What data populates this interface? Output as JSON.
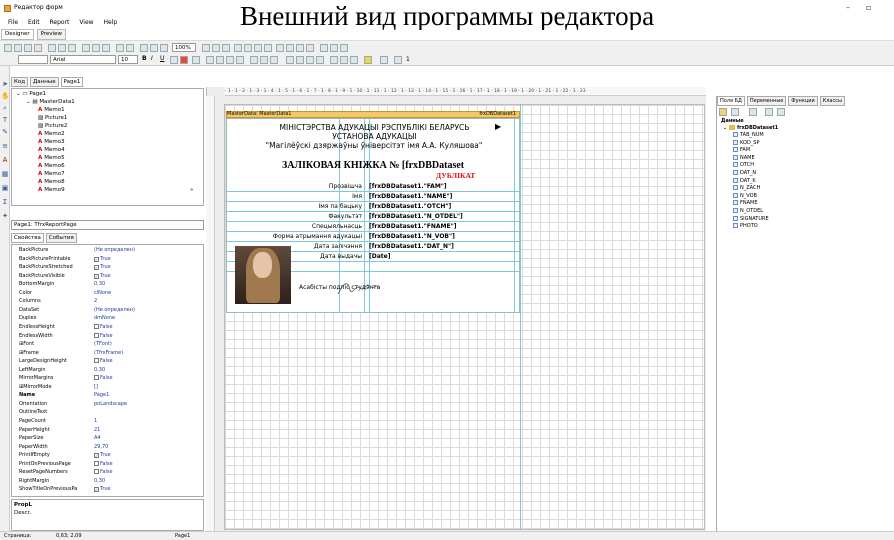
{
  "caption": "Внешний вид программы редактора",
  "window": {
    "title": "Редактор форм",
    "controls": [
      "–",
      "▫"
    ]
  },
  "menu": [
    "File",
    "Edit",
    "Report",
    "View",
    "Help"
  ],
  "mode_tabs": [
    "Designer",
    "Preview"
  ],
  "toolbar": {
    "zoom": "100%",
    "font_name": "Arial",
    "font_size": "10",
    "bold": "B",
    "italic": "I",
    "underline": "U",
    "line_width": "1"
  },
  "left_panel_tabs": [
    "Код",
    "Данные",
    "Page1"
  ],
  "tree": {
    "items": [
      {
        "label": "Page1",
        "level": 0,
        "icon": "page-icon"
      },
      {
        "label": "MasterData1",
        "level": 1,
        "icon": "band-icon"
      },
      {
        "label": "Memo1",
        "level": 2,
        "icon": "memo-icon"
      },
      {
        "label": "Picture1",
        "level": 2,
        "icon": "picture-icon"
      },
      {
        "label": "Picture2",
        "level": 2,
        "icon": "picture-icon"
      },
      {
        "label": "Memo2",
        "level": 2,
        "icon": "memo-icon"
      },
      {
        "label": "Memo3",
        "level": 2,
        "icon": "memo-icon"
      },
      {
        "label": "Memo4",
        "level": 2,
        "icon": "memo-icon"
      },
      {
        "label": "Memo5",
        "level": 2,
        "icon": "memo-icon"
      },
      {
        "label": "Memo6",
        "level": 2,
        "icon": "memo-icon"
      },
      {
        "label": "Memo7",
        "level": 2,
        "icon": "memo-icon"
      },
      {
        "label": "Memo8",
        "level": 2,
        "icon": "memo-icon"
      },
      {
        "label": "Memo9",
        "level": 2,
        "icon": "memo-icon"
      }
    ]
  },
  "object_combo": "Page1: TfrxReportPage",
  "inspector_tabs": [
    "Свойства",
    "События"
  ],
  "properties": [
    {
      "name": "BackPicture",
      "value": "(Не определен)",
      "check": null,
      "bold": false
    },
    {
      "name": "BackPicturePrintable",
      "value": "True",
      "check": true,
      "bold": false
    },
    {
      "name": "BackPictureStretched",
      "value": "True",
      "check": true,
      "bold": false
    },
    {
      "name": "BackPictureVisible",
      "value": "True",
      "check": true,
      "bold": false
    },
    {
      "name": "BottomMargin",
      "value": "0,30",
      "check": null,
      "bold": false
    },
    {
      "name": "Color",
      "value": "clNone",
      "check": null,
      "bold": false
    },
    {
      "name": "Columns",
      "value": "2",
      "check": null,
      "bold": false
    },
    {
      "name": "DataSet",
      "value": "(Не определен)",
      "check": null,
      "bold": false
    },
    {
      "name": "Duplex",
      "value": "dmNone",
      "check": null,
      "bold": false
    },
    {
      "name": "EndlessHeight",
      "value": "False",
      "check": false,
      "bold": false
    },
    {
      "name": "EndlessWidth",
      "value": "False",
      "check": false,
      "bold": false
    },
    {
      "name": "⊞Font",
      "value": "(TFont)",
      "check": null,
      "bold": false
    },
    {
      "name": "⊞Frame",
      "value": "(TfrxFrame)",
      "check": null,
      "bold": false
    },
    {
      "name": "LargeDesignHeight",
      "value": "False",
      "check": false,
      "bold": false
    },
    {
      "name": "LeftMargin",
      "value": "0,30",
      "check": null,
      "bold": false
    },
    {
      "name": "MirrorMargins",
      "value": "False",
      "check": false,
      "bold": false
    },
    {
      "name": "⊞MirrorMode",
      "value": "[]",
      "check": null,
      "bold": false
    },
    {
      "name": "Name",
      "value": "Page1",
      "check": null,
      "bold": true
    },
    {
      "name": "Orientation",
      "value": "poLandscape",
      "check": null,
      "bold": false
    },
    {
      "name": "OutlineText",
      "value": "",
      "check": null,
      "bold": false
    },
    {
      "name": "PageCount",
      "value": "1",
      "check": null,
      "bold": false
    },
    {
      "name": "PaperHeight",
      "value": "21",
      "check": null,
      "bold": false
    },
    {
      "name": "PaperSize",
      "value": "A4",
      "check": null,
      "bold": false
    },
    {
      "name": "PaperWidth",
      "value": "29,70",
      "check": null,
      "bold": false
    },
    {
      "name": "PrintIfEmpty",
      "value": "True",
      "check": true,
      "bold": false
    },
    {
      "name": "PrintOnPreviousPage",
      "value": "False",
      "check": false,
      "bold": false
    },
    {
      "name": "ResetPageNumbers",
      "value": "False",
      "check": false,
      "bold": false
    },
    {
      "name": "RightMargin",
      "value": "0,30",
      "check": null,
      "bold": false
    },
    {
      "name": "ShowTitleOnPreviousPa",
      "value": "True",
      "check": true,
      "bold": false
    }
  ],
  "prop_footer": [
    "PropL",
    "Descr."
  ],
  "ruler_text": "· 1 · 1 · 2 · 1 · 3 · 1 · 4 · 1 · 5 · 1 · 6 · 1 · 7 · 1 · 8 · 1 · 9 · 1 · 10 · 1 · 11 · 1 · 12 · 1 · 13 · 1 · 14 · 1 · 15 · 1 · 16 · 1 · 17 · 1 · 18 · 1 · 19 · 1 · 20 · 1 · 21 · 1 · 22 · 1 · 23",
  "band": {
    "left": "MasterData: MasterData1",
    "right": "frxDBDataset1"
  },
  "report": {
    "line1": "МІНІСТЭРСТВА АДУКАЦЫІ РЭСПУБЛІКІ БЕЛАРУСЬ",
    "line2": "УСТАНОВА АДУКАЦЫІ",
    "line3": "\"Магілёўскі дзяржаўны ўніверсітэт імя А.А. Куляшова\"",
    "heading": "ЗАЛІКОВАЯ КНІЖКА № [frxDBDataset",
    "duplicate": "ДУБЛІКАТ",
    "rows": [
      {
        "label": "Прозвішча",
        "field": "[frxDBDataset1.\"FAM\"]"
      },
      {
        "label": "Імя",
        "field": "[frxDBDataset1.\"NAME\"]"
      },
      {
        "label": "Імя па бацьку",
        "field": "[frxDBDataset1.\"OTCH\"]"
      },
      {
        "label": "Факультэт",
        "field": "[frxDBDataset1.\"N_OTDEL\"]"
      },
      {
        "label": "Спецыяльнасць",
        "field": "[frxDBDataset1.\"FNAME\"]"
      },
      {
        "label": "Форма атрымання адукацыі",
        "field": "[frxDBDataset1.\"N_VOB\"]"
      },
      {
        "label": "Дата залічэння",
        "field": "[frxDBDataset1.\"DAT_N\"]"
      },
      {
        "label": "Дата выдачы",
        "field": "[Date]"
      }
    ],
    "signature_label": "Асабісты подпіс студэнта"
  },
  "right_panel": {
    "tabs": [
      "Поля БД",
      "Переменные",
      "Функции",
      "Классы"
    ],
    "root": "Данные",
    "dataset": "frxDBDataset1",
    "fields": [
      "TAB_NUM",
      "KOD_SP",
      "FAM",
      "NAME",
      "OTCH",
      "DAT_N",
      "DAT_K",
      "N_ZACH",
      "N_VOB",
      "FNAME",
      "N_OTDEL",
      "SIGNATURE",
      "PHOTO"
    ]
  },
  "status": [
    "Страница:",
    "0,63; 2,09",
    "Page1"
  ]
}
